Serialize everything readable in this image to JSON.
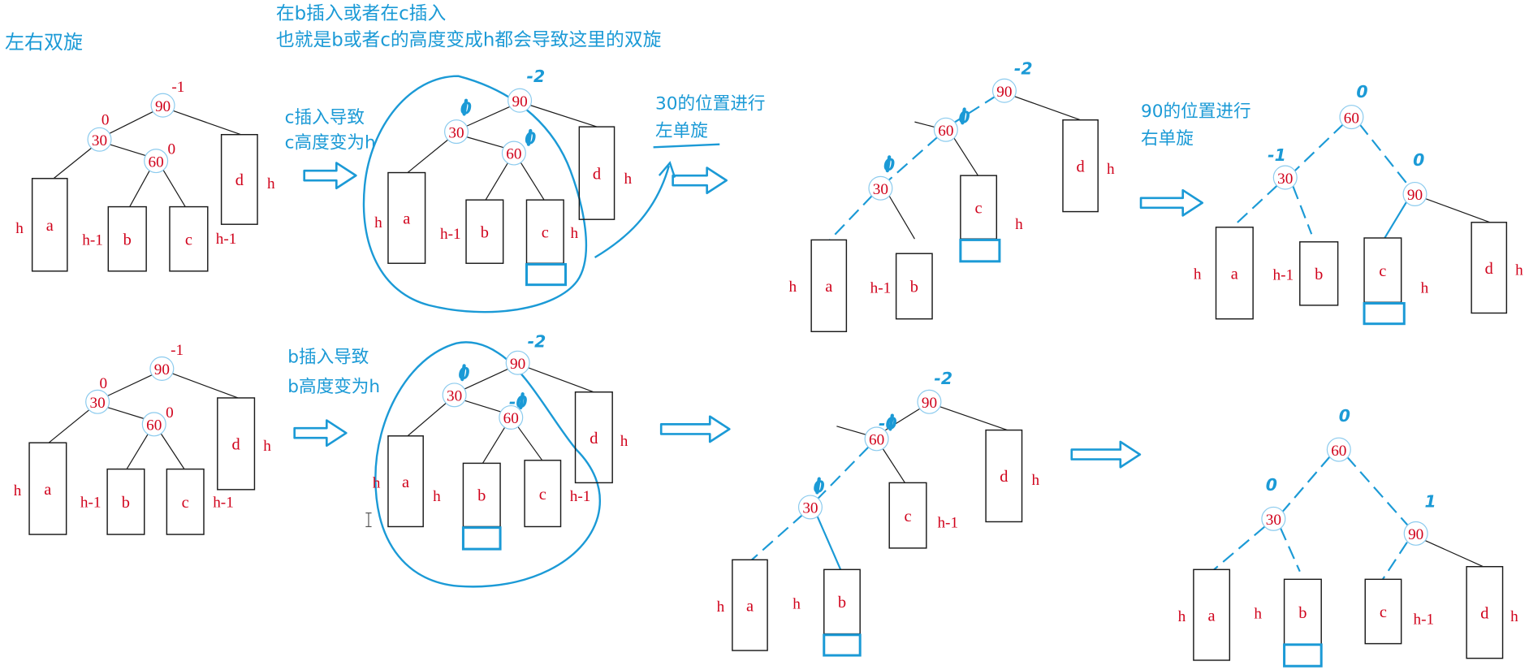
{
  "header": {
    "title": "左右双旋",
    "note_line1": "在b插入或者在c插入",
    "note_line2": "也就是b或者c的高度变成h都会导致这里的双旋"
  },
  "captions": {
    "c_insert_line1": "c插入导致",
    "c_insert_line2": "c高度变为h",
    "rotate_left_line1": "30的位置进行",
    "rotate_left_line2": "左单旋",
    "rotate_right_line1": "90的位置进行",
    "rotate_right_line2": "右单旋",
    "b_insert_line1": "b插入导致",
    "b_insert_line2": "b高度变为h"
  },
  "colors": {
    "annotation": "#1b9ad6",
    "label": "#d0021b",
    "node_ring": "#8ccbee",
    "outline": "#1a1a1a"
  },
  "trees": [
    {
      "nodes": [
        {
          "key": "90",
          "bf": "-1"
        },
        {
          "key": "30",
          "bf": "0"
        },
        {
          "key": "60",
          "bf": "0"
        }
      ],
      "subtrees": [
        {
          "name": "a",
          "height": "h"
        },
        {
          "name": "b",
          "height": "h-1"
        },
        {
          "name": "c",
          "height": "h-1"
        },
        {
          "name": "d",
          "height": "h"
        }
      ]
    },
    {
      "nodes": [
        {
          "key": "90",
          "bf": "-2"
        },
        {
          "key": "30",
          "bf": "0"
        },
        {
          "key": "60",
          "bf": "0"
        }
      ],
      "subtrees": [
        {
          "name": "a",
          "height": "h"
        },
        {
          "name": "b",
          "height": "h-1"
        },
        {
          "name": "c",
          "height": "h"
        },
        {
          "name": "d",
          "height": "h"
        }
      ]
    },
    {
      "nodes": [
        {
          "key": "90",
          "bf": "-2"
        },
        {
          "key": "60",
          "bf": "0"
        },
        {
          "key": "30",
          "bf": "0"
        }
      ],
      "subtrees": [
        {
          "name": "a",
          "height": "h"
        },
        {
          "name": "b",
          "height": "h-1"
        },
        {
          "name": "c",
          "height": "h"
        },
        {
          "name": "d",
          "height": "h"
        }
      ]
    },
    {
      "nodes": [
        {
          "key": "60",
          "bf": "0"
        },
        {
          "key": "30",
          "bf": "-1"
        },
        {
          "key": "90",
          "bf": "0"
        }
      ],
      "subtrees": [
        {
          "name": "a",
          "height": "h"
        },
        {
          "name": "b",
          "height": "h-1"
        },
        {
          "name": "c",
          "height": "h"
        },
        {
          "name": "d",
          "height": "h"
        }
      ]
    },
    {
      "nodes": [
        {
          "key": "90",
          "bf": "-1"
        },
        {
          "key": "30",
          "bf": "0"
        },
        {
          "key": "60",
          "bf": "0"
        }
      ],
      "subtrees": [
        {
          "name": "a",
          "height": "h"
        },
        {
          "name": "b",
          "height": "h-1"
        },
        {
          "name": "c",
          "height": "h-1"
        },
        {
          "name": "d",
          "height": "h"
        }
      ]
    },
    {
      "nodes": [
        {
          "key": "90",
          "bf": "-2"
        },
        {
          "key": "30",
          "bf": "0"
        },
        {
          "key": "60",
          "bf": "-0"
        }
      ],
      "subtrees": [
        {
          "name": "a",
          "height": "h"
        },
        {
          "name": "b",
          "height": "h"
        },
        {
          "name": "c",
          "height": "h-1"
        },
        {
          "name": "d",
          "height": "h"
        }
      ]
    },
    {
      "nodes": [
        {
          "key": "90",
          "bf": "-2"
        },
        {
          "key": "60",
          "bf": "-0"
        },
        {
          "key": "30",
          "bf": "0"
        }
      ],
      "subtrees": [
        {
          "name": "a",
          "height": "h"
        },
        {
          "name": "b",
          "height": "h"
        },
        {
          "name": "c",
          "height": "h-1"
        },
        {
          "name": "d",
          "height": "h"
        }
      ]
    },
    {
      "nodes": [
        {
          "key": "60",
          "bf": "0"
        },
        {
          "key": "30",
          "bf": "0"
        },
        {
          "key": "90",
          "bf": "1"
        }
      ],
      "subtrees": [
        {
          "name": "a",
          "height": "h"
        },
        {
          "name": "b",
          "height": "h"
        },
        {
          "name": "c",
          "height": "h-1"
        },
        {
          "name": "d",
          "height": "h"
        }
      ]
    }
  ]
}
